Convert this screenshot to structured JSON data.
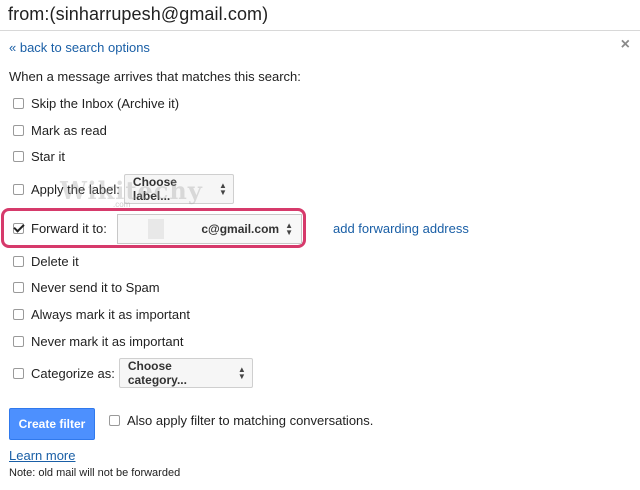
{
  "search": {
    "query": "from:(sinharrupesh@gmail.com)"
  },
  "back_link": "« back to search options",
  "close_symbol": "×",
  "intro": "When a message arrives that matches this search:",
  "options": {
    "skip_inbox": {
      "label": "Skip the Inbox (Archive it)",
      "checked": false
    },
    "mark_read": {
      "label": "Mark as read",
      "checked": false
    },
    "star": {
      "label": "Star it",
      "checked": false
    },
    "apply_label": {
      "label": "Apply the label:",
      "checked": false,
      "select": "Choose label..."
    },
    "forward": {
      "label": "Forward it to:",
      "checked": true,
      "select": "c@gmail.com"
    },
    "delete": {
      "label": "Delete it",
      "checked": false
    },
    "never_spam": {
      "label": "Never send it to Spam",
      "checked": false
    },
    "always_important": {
      "label": "Always mark it as important",
      "checked": false
    },
    "never_important": {
      "label": "Never mark it as important",
      "checked": false
    },
    "categorize": {
      "label": "Categorize as:",
      "checked": false,
      "select": "Choose category..."
    }
  },
  "add_forwarding": "add forwarding address",
  "watermark": {
    "text": "Wikitechy",
    "sub": ".com"
  },
  "create_button": "Create filter",
  "also_apply": "Also apply filter to matching conversations.",
  "learn_more": "Learn more",
  "note": "Note: old mail will not be forwarded",
  "colors": {
    "link": "#1a5fa6",
    "primary": "#4d90fe",
    "highlight": "#d63a6b"
  }
}
